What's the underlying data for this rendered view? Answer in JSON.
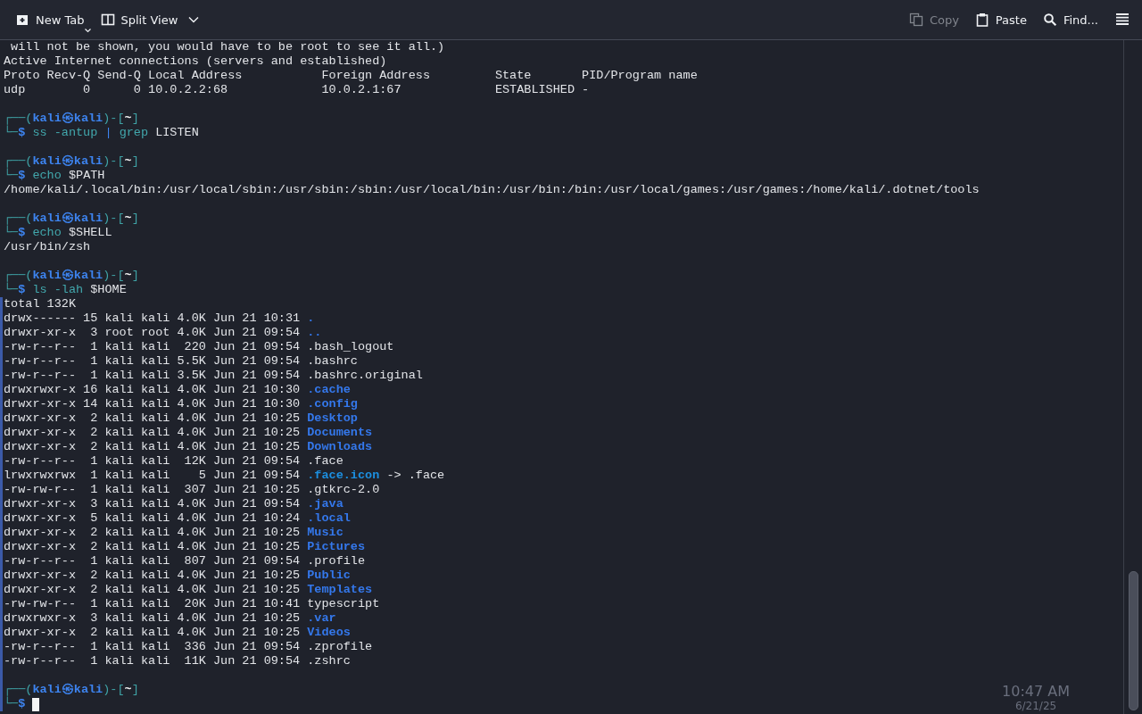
{
  "toolbar": {
    "left": [
      {
        "label": "New Tab",
        "disabled": false
      },
      {
        "label": "Split View",
        "disabled": false
      }
    ],
    "right": [
      {
        "label": "Copy",
        "disabled": true
      },
      {
        "label": "Paste",
        "disabled": false
      },
      {
        "label": "Find...",
        "disabled": false
      }
    ]
  },
  "lines": [
    {
      "kind": "output",
      "segments": [
        {
          "text": " will not be shown, you would have to be root to see it all.)",
          "kind": "plain"
        }
      ]
    },
    {
      "kind": "output",
      "segments": [
        {
          "text": "Active Internet connections (servers and established)",
          "kind": "plain"
        }
      ]
    },
    {
      "kind": "output",
      "segments": [
        {
          "text": "Proto Recv-Q Send-Q Local Address           Foreign Address         State       PID/Program name",
          "kind": "plain"
        }
      ]
    },
    {
      "kind": "output",
      "segments": [
        {
          "text": "udp        0      0 10.0.2.2:68             10.0.2.1:67             ESTABLISHED -",
          "kind": "plain"
        }
      ]
    },
    {
      "kind": "blank"
    },
    {
      "kind": "prompt",
      "segments": [
        {
          "text": "┌──(",
          "kind": "frame"
        },
        {
          "text": "kali㉿kali",
          "kind": "user"
        },
        {
          "text": ")-[",
          "kind": "frame"
        },
        {
          "text": "~",
          "kind": "dir"
        },
        {
          "text": "]",
          "kind": "frame"
        }
      ]
    },
    {
      "kind": "command",
      "segments": [
        {
          "text": "└─",
          "kind": "frame"
        },
        {
          "text": "$",
          "kind": "symbol"
        },
        {
          "text": " ss -antup",
          "kind": "cmd"
        },
        {
          "text": " |",
          "kind": "op"
        },
        {
          "text": " grep",
          "kind": "cmd"
        },
        {
          "text": " LISTEN",
          "kind": "plain"
        }
      ]
    },
    {
      "kind": "blank"
    },
    {
      "kind": "prompt",
      "segments": [
        {
          "text": "┌──(",
          "kind": "frame"
        },
        {
          "text": "kali㉿kali",
          "kind": "user"
        },
        {
          "text": ")-[",
          "kind": "frame"
        },
        {
          "text": "~",
          "kind": "dir"
        },
        {
          "text": "]",
          "kind": "frame"
        }
      ]
    },
    {
      "kind": "command",
      "segments": [
        {
          "text": "└─",
          "kind": "frame"
        },
        {
          "text": "$",
          "kind": "symbol"
        },
        {
          "text": " echo",
          "kind": "cmd"
        },
        {
          "text": " $PATH",
          "kind": "plain"
        }
      ]
    },
    {
      "kind": "output",
      "segments": [
        {
          "text": "/home/kali/.local/bin:/usr/local/sbin:/usr/sbin:/sbin:/usr/local/bin:/usr/bin:/bin:/usr/local/games:/usr/games:/home/kali/.dotnet/tools",
          "kind": "plain"
        }
      ]
    },
    {
      "kind": "blank"
    },
    {
      "kind": "prompt",
      "segments": [
        {
          "text": "┌──(",
          "kind": "frame"
        },
        {
          "text": "kali㉿kali",
          "kind": "user"
        },
        {
          "text": ")-[",
          "kind": "frame"
        },
        {
          "text": "~",
          "kind": "dir"
        },
        {
          "text": "]",
          "kind": "frame"
        }
      ]
    },
    {
      "kind": "command",
      "segments": [
        {
          "text": "└─",
          "kind": "frame"
        },
        {
          "text": "$",
          "kind": "symbol"
        },
        {
          "text": " echo",
          "kind": "cmd"
        },
        {
          "text": " $SHELL",
          "kind": "plain"
        }
      ]
    },
    {
      "kind": "output",
      "segments": [
        {
          "text": "/usr/bin/zsh",
          "kind": "plain"
        }
      ]
    },
    {
      "kind": "blank"
    },
    {
      "kind": "prompt",
      "segments": [
        {
          "text": "┌──(",
          "kind": "frame"
        },
        {
          "text": "kali㉿kali",
          "kind": "user"
        },
        {
          "text": ")-[",
          "kind": "frame"
        },
        {
          "text": "~",
          "kind": "dir"
        },
        {
          "text": "]",
          "kind": "frame"
        }
      ]
    },
    {
      "kind": "command",
      "segments": [
        {
          "text": "└─",
          "kind": "frame"
        },
        {
          "text": "$",
          "kind": "symbol"
        },
        {
          "text": " ls -lah",
          "kind": "cmd"
        },
        {
          "text": " $HOME",
          "kind": "plain"
        }
      ]
    }
  ],
  "marked_lines": [
    {
      "kind": "output",
      "segments": [
        {
          "text": "total 132K",
          "kind": "plain"
        }
      ]
    },
    {
      "kind": "listing",
      "segments": [
        {
          "text": "drwx------ 15 kali kali 4.0K Jun 21 10:31 ",
          "kind": "plain"
        },
        {
          "text": ".",
          "kind": "folder"
        }
      ]
    },
    {
      "kind": "listing",
      "segments": [
        {
          "text": "drwxr-xr-x  3 root root 4.0K Jun 21 09:54 ",
          "kind": "plain"
        },
        {
          "text": "..",
          "kind": "folder"
        }
      ]
    },
    {
      "kind": "listing",
      "segments": [
        {
          "text": "-rw-r--r--  1 kali kali  220 Jun 21 09:54 .bash_logout",
          "kind": "plain"
        }
      ]
    },
    {
      "kind": "listing",
      "segments": [
        {
          "text": "-rw-r--r--  1 kali kali 5.5K Jun 21 09:54 .bashrc",
          "kind": "plain"
        }
      ]
    },
    {
      "kind": "listing",
      "segments": [
        {
          "text": "-rw-r--r--  1 kali kali 3.5K Jun 21 09:54 .bashrc.original",
          "kind": "plain"
        }
      ]
    },
    {
      "kind": "listing",
      "segments": [
        {
          "text": "drwxrwxr-x 16 kali kali 4.0K Jun 21 10:30 ",
          "kind": "plain"
        },
        {
          "text": ".cache",
          "kind": "folder"
        }
      ]
    },
    {
      "kind": "listing",
      "segments": [
        {
          "text": "drwxr-xr-x 14 kali kali 4.0K Jun 21 10:30 ",
          "kind": "plain"
        },
        {
          "text": ".config",
          "kind": "folder"
        }
      ]
    },
    {
      "kind": "listing",
      "segments": [
        {
          "text": "drwxr-xr-x  2 kali kali 4.0K Jun 21 10:25 ",
          "kind": "plain"
        },
        {
          "text": "Desktop",
          "kind": "folder"
        }
      ]
    },
    {
      "kind": "listing",
      "segments": [
        {
          "text": "drwxr-xr-x  2 kali kali 4.0K Jun 21 10:25 ",
          "kind": "plain"
        },
        {
          "text": "Documents",
          "kind": "folder"
        }
      ]
    },
    {
      "kind": "listing",
      "segments": [
        {
          "text": "drwxr-xr-x  2 kali kali 4.0K Jun 21 10:25 ",
          "kind": "plain"
        },
        {
          "text": "Downloads",
          "kind": "folder"
        }
      ]
    },
    {
      "kind": "listing",
      "segments": [
        {
          "text": "-rw-r--r--  1 kali kali  12K Jun 21 09:54 .face",
          "kind": "plain"
        }
      ]
    },
    {
      "kind": "listing",
      "segments": [
        {
          "text": "lrwxrwxrwx  1 kali kali    5 Jun 21 09:54 ",
          "kind": "plain"
        },
        {
          "text": ".face.icon",
          "kind": "link"
        },
        {
          "text": " -> .face",
          "kind": "plain"
        }
      ]
    },
    {
      "kind": "listing",
      "segments": [
        {
          "text": "-rw-rw-r--  1 kali kali  307 Jun 21 10:25 .gtkrc-2.0",
          "kind": "plain"
        }
      ]
    },
    {
      "kind": "listing",
      "segments": [
        {
          "text": "drwxr-xr-x  3 kali kali 4.0K Jun 21 09:54 ",
          "kind": "plain"
        },
        {
          "text": ".java",
          "kind": "folder"
        }
      ]
    },
    {
      "kind": "listing",
      "segments": [
        {
          "text": "drwxr-xr-x  5 kali kali 4.0K Jun 21 10:24 ",
          "kind": "plain"
        },
        {
          "text": ".local",
          "kind": "folder"
        }
      ]
    },
    {
      "kind": "listing",
      "segments": [
        {
          "text": "drwxr-xr-x  2 kali kali 4.0K Jun 21 10:25 ",
          "kind": "plain"
        },
        {
          "text": "Music",
          "kind": "folder"
        }
      ]
    },
    {
      "kind": "listing",
      "segments": [
        {
          "text": "drwxr-xr-x  2 kali kali 4.0K Jun 21 10:25 ",
          "kind": "plain"
        },
        {
          "text": "Pictures",
          "kind": "folder"
        }
      ]
    },
    {
      "kind": "listing",
      "segments": [
        {
          "text": "-rw-r--r--  1 kali kali  807 Jun 21 09:54 .profile",
          "kind": "plain"
        }
      ]
    },
    {
      "kind": "listing",
      "segments": [
        {
          "text": "drwxr-xr-x  2 kali kali 4.0K Jun 21 10:25 ",
          "kind": "plain"
        },
        {
          "text": "Public",
          "kind": "folder"
        }
      ]
    },
    {
      "kind": "listing",
      "segments": [
        {
          "text": "drwxr-xr-x  2 kali kali 4.0K Jun 21 10:25 ",
          "kind": "plain"
        },
        {
          "text": "Templates",
          "kind": "folder"
        }
      ]
    },
    {
      "kind": "listing",
      "segments": [
        {
          "text": "-rw-rw-r--  1 kali kali  20K Jun 21 10:41 typescript",
          "kind": "plain"
        }
      ]
    },
    {
      "kind": "listing",
      "segments": [
        {
          "text": "drwxrwxr-x  3 kali kali 4.0K Jun 21 10:25 ",
          "kind": "plain"
        },
        {
          "text": ".var",
          "kind": "folder"
        }
      ]
    },
    {
      "kind": "listing",
      "segments": [
        {
          "text": "drwxr-xr-x  2 kali kali 4.0K Jun 21 10:25 ",
          "kind": "plain"
        },
        {
          "text": "Videos",
          "kind": "folder"
        }
      ]
    },
    {
      "kind": "listing",
      "segments": [
        {
          "text": "-rw-r--r--  1 kali kali  336 Jun 21 09:54 .zprofile",
          "kind": "plain"
        }
      ]
    },
    {
      "kind": "listing",
      "segments": [
        {
          "text": "-rw-r--r--  1 kali kali  11K Jun 21 09:54 .zshrc",
          "kind": "plain"
        }
      ]
    },
    {
      "kind": "blank"
    },
    {
      "kind": "prompt",
      "segments": [
        {
          "text": "┌──(",
          "kind": "frame"
        },
        {
          "text": "kali㉿kali",
          "kind": "user"
        },
        {
          "text": ")-[",
          "kind": "frame"
        },
        {
          "text": "~",
          "kind": "dir"
        },
        {
          "text": "]",
          "kind": "frame"
        }
      ]
    },
    {
      "kind": "input",
      "segments": [
        {
          "text": "└─",
          "kind": "frame"
        },
        {
          "text": "$",
          "kind": "symbol"
        }
      ]
    }
  ],
  "panel_behind": {
    "time": "10:47 AM",
    "date": "6/21/25"
  }
}
